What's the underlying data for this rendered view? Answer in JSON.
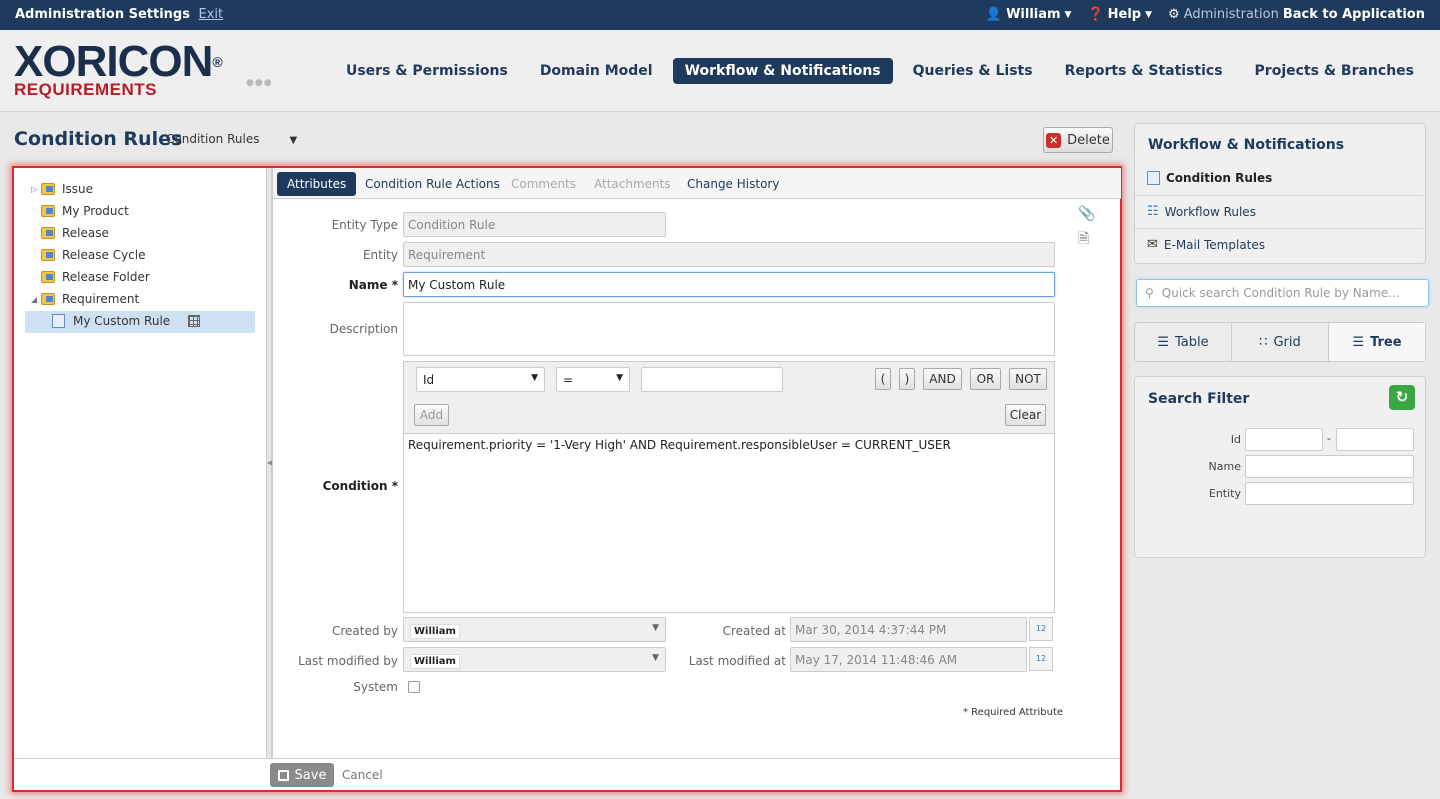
{
  "topbar": {
    "title": "Administration Settings",
    "exit": "Exit",
    "user": "William",
    "help": "Help",
    "admin_dim": "Administration",
    "back": "Back to Application"
  },
  "logo": {
    "main": "XORICON",
    "sub": "REQUIREMENTS"
  },
  "nav": {
    "items": [
      "Users & Permissions",
      "Domain Model",
      "Workflow & Notifications",
      "Queries & Lists",
      "Reports & Statistics",
      "Projects & Branches"
    ],
    "active_index": 2
  },
  "page": {
    "title": "Condition Rules",
    "select_value": "Condition Rules",
    "delete": "Delete"
  },
  "tree": {
    "items": [
      "Issue",
      "My Product",
      "Release",
      "Release Cycle",
      "Release Folder",
      "Requirement"
    ],
    "selected": "My Custom Rule"
  },
  "tabs": [
    "Attributes",
    "Condition Rule Actions",
    "Comments",
    "Attachments",
    "Change History"
  ],
  "form": {
    "entity_type_label": "Entity Type",
    "entity_type_value": "Condition Rule",
    "entity_label": "Entity",
    "entity_value": "Requirement",
    "name_label": "Name *",
    "name_value": "My Custom Rule",
    "description_label": "Description",
    "condition_label": "Condition *",
    "cond_attr": "Id",
    "cond_op": "=",
    "btn_lparen": "(",
    "btn_rparen": ")",
    "btn_and": "AND",
    "btn_or": "OR",
    "btn_not": "NOT",
    "btn_add": "Add",
    "btn_clear": "Clear",
    "condition_text": "Requirement.priority = '1-Very High' AND Requirement.responsibleUser = CURRENT_USER",
    "created_by_label": "Created by",
    "created_by": "William",
    "modified_by_label": "Last modified by",
    "modified_by": "William",
    "created_at_label": "Created at",
    "created_at": "Mar 30, 2014 4:37:44 PM",
    "modified_at_label": "Last modified at",
    "modified_at": "May 17, 2014 11:48:46 AM",
    "system_label": "System",
    "required_note": "* Required Attribute",
    "cal_day": "12"
  },
  "footer": {
    "save": "Save",
    "cancel": "Cancel"
  },
  "sidebar": {
    "title": "Workflow & Notifications",
    "links": [
      "Condition Rules",
      "Workflow Rules",
      "E-Mail Templates"
    ],
    "search_placeholder": "Quick search Condition Rule by Name...",
    "views": [
      "Table",
      "Grid",
      "Tree"
    ],
    "filter_title": "Search Filter",
    "filter_labels": [
      "Id",
      "Name",
      "Entity"
    ],
    "range_sep": "-"
  },
  "colors": {
    "brand_navy": "#1e3a5c",
    "brand_red": "#b51e27",
    "highlight_red": "#e02a2a",
    "refresh_green": "#3aa842"
  }
}
